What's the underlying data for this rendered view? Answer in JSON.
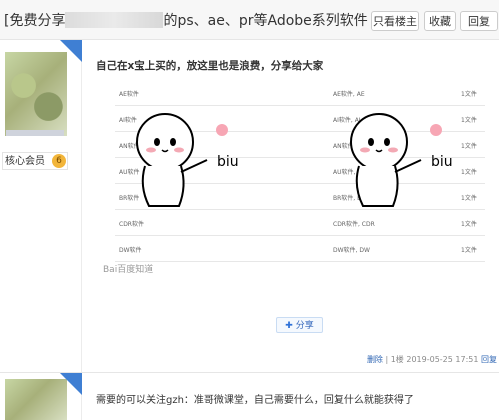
{
  "thread": {
    "title_prefix": "[免费分享",
    "title_suffix": "的ps、ae、pr等Adobe系列软件",
    "buttons": {
      "only_op": "只看楼主",
      "favorite": "收藏",
      "reply": "回复"
    }
  },
  "user": {
    "role": "核心会员",
    "level": "6"
  },
  "post": {
    "title": "自己在x宝上买的，放这里也是浪费，分享给大家",
    "rows": [
      [
        "AE软件",
        "AE软件, AE",
        "1文件"
      ],
      [
        "AI软件",
        "AI软件, AI",
        "1文件"
      ],
      [
        "AN软件",
        "AN软件, AN",
        "1文件"
      ],
      [
        "AU软件",
        "AU软件, AU",
        "1文件"
      ],
      [
        "BR软件",
        "BR软件, BR",
        "1文件"
      ],
      [
        "CDR软件",
        "CDR软件, CDR",
        "1文件"
      ],
      [
        "DW软件",
        "DW软件, DW",
        "1文件"
      ]
    ],
    "watermark": "Bai百度知道",
    "share": "分享",
    "meta": {
      "delete": "删除",
      "floor": "1楼",
      "time": "2019-05-25 17:51",
      "reply": "回复"
    }
  },
  "reply2": {
    "text": "需要的可以关注gzh：准哥微课堂，自己需要什么，回复什么就能获得了"
  }
}
